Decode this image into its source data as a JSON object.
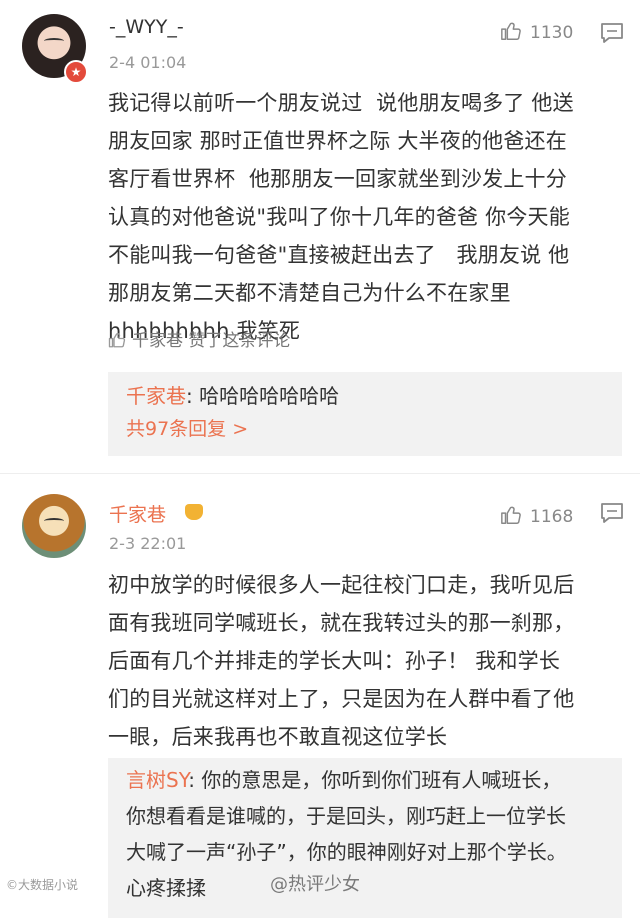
{
  "comments": [
    {
      "user": "-_WYY_-",
      "time": "2-4 01:04",
      "likes": "1130",
      "body": "我记得以前听一个朋友说过  说他朋友喝多了 他送\n朋友回家 那时正值世界杯之际 大半夜的他爸还在\n客厅看世界杯  他那朋友一回家就坐到沙发上十分\n认真的对他爸说\"我叫了你十几年的爸爸 你今天能\n不能叫我一句爸爸\"直接被赶出去了   我朋友说 他\n那朋友第二天都不清楚自己为什么不在家里\nhhhhhhhhh 我笑死",
      "liked_by": "千家巷 赞了这条评论",
      "reply": {
        "author": "千家巷",
        "separator": ": ",
        "text": "哈哈哈哈哈哈哈",
        "count_label": "共97条回复 >"
      }
    },
    {
      "user": "千家巷",
      "time": "2-3 22:01",
      "likes": "1168",
      "body": "初中放学的时候很多人一起往校门口走，我听见后\n面有我班同学喊班长，就在我转过头的那一刹那，\n后面有几个并排走的学长大叫：孙子！ 我和学长\n们的目光就这样对上了，只是因为在人群中看了他\n一眼，后来我再也不敢直视这位学长",
      "reply": {
        "author": "言树SY",
        "separator": ": ",
        "text": "你的意思是，你听到你们班有人喊班长，\n你想看看是谁喊的，于是回头，刚巧赶上一位学长\n大喊了一声“孙子”，你的眼神刚好对上那个学长。\n心疼揉揉"
      }
    }
  ],
  "watermarks": {
    "left": "©大数据小说",
    "center": "@热评少女"
  },
  "icons": {
    "like": "thumbs-up-icon",
    "reply": "comment-icon",
    "verified": "verified-badge-icon",
    "crown": "crown-icon"
  }
}
